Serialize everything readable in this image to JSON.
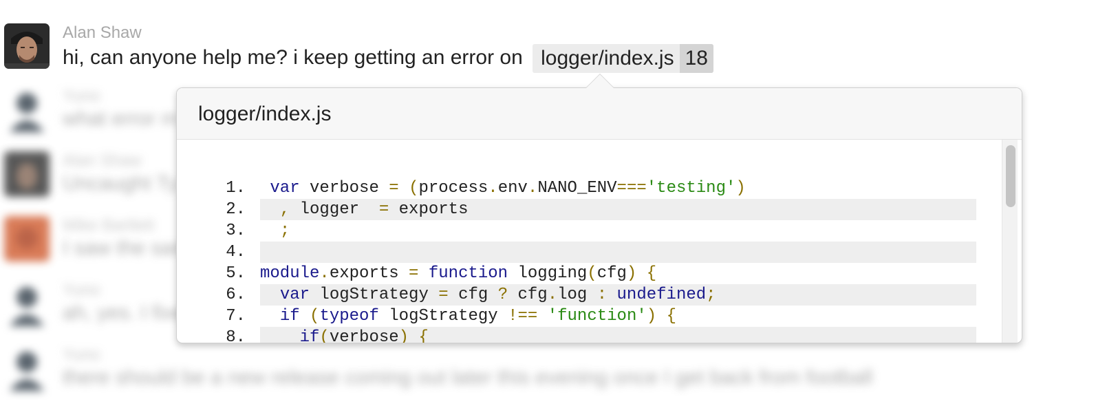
{
  "messages": [
    {
      "author": "Alan Shaw",
      "text": "hi, can anyone help me? i keep getting an error on",
      "file": "logger/index.js",
      "line": "18"
    },
    {
      "author": "Yuno",
      "text": "what error m"
    },
    {
      "author": "Alan Shaw",
      "text": "Uncaught Ty"
    },
    {
      "author": "Mike Bartlett",
      "text": "I saw the sam"
    },
    {
      "author": "Yuno",
      "text": "ah, yes. I fixe"
    },
    {
      "author": "Yuno",
      "text": "there should be a new release coming out later this evening once I get back from football"
    }
  ],
  "popover": {
    "title": "logger/index.js",
    "lines": [
      {
        "num": "1.",
        "tokens": [
          {
            "t": " "
          },
          {
            "t": "var",
            "c": "kw"
          },
          {
            "t": " verbose "
          },
          {
            "t": "=",
            "c": "op"
          },
          {
            "t": " "
          },
          {
            "t": "(",
            "c": "op"
          },
          {
            "t": "process"
          },
          {
            "t": ".",
            "c": "op"
          },
          {
            "t": "env"
          },
          {
            "t": ".",
            "c": "op"
          },
          {
            "t": "NANO_ENV"
          },
          {
            "t": "===",
            "c": "op"
          },
          {
            "t": "'testing'",
            "c": "str"
          },
          {
            "t": ")",
            "c": "op"
          }
        ]
      },
      {
        "num": "2.",
        "tokens": [
          {
            "t": "  "
          },
          {
            "t": ",",
            "c": "op"
          },
          {
            "t": " logger  "
          },
          {
            "t": "=",
            "c": "op"
          },
          {
            "t": " exports"
          }
        ]
      },
      {
        "num": "3.",
        "tokens": [
          {
            "t": "  "
          },
          {
            "t": ";",
            "c": "op"
          }
        ]
      },
      {
        "num": "4.",
        "tokens": []
      },
      {
        "num": "5.",
        "tokens": [
          {
            "t": "module",
            "c": "kw"
          },
          {
            "t": ".",
            "c": "op"
          },
          {
            "t": "exports "
          },
          {
            "t": "=",
            "c": "op"
          },
          {
            "t": " "
          },
          {
            "t": "function",
            "c": "kw"
          },
          {
            "t": " logging"
          },
          {
            "t": "(",
            "c": "op"
          },
          {
            "t": "cfg"
          },
          {
            "t": ")",
            "c": "op"
          },
          {
            "t": " "
          },
          {
            "t": "{",
            "c": "op"
          }
        ]
      },
      {
        "num": "6.",
        "tokens": [
          {
            "t": "  "
          },
          {
            "t": "var",
            "c": "kw"
          },
          {
            "t": " logStrategy "
          },
          {
            "t": "=",
            "c": "op"
          },
          {
            "t": " cfg "
          },
          {
            "t": "?",
            "c": "op"
          },
          {
            "t": " cfg"
          },
          {
            "t": ".",
            "c": "op"
          },
          {
            "t": "log "
          },
          {
            "t": ":",
            "c": "op"
          },
          {
            "t": " "
          },
          {
            "t": "undefined",
            "c": "kw"
          },
          {
            "t": ";",
            "c": "op"
          }
        ]
      },
      {
        "num": "7.",
        "tokens": [
          {
            "t": "  "
          },
          {
            "t": "if",
            "c": "kw"
          },
          {
            "t": " "
          },
          {
            "t": "(",
            "c": "op"
          },
          {
            "t": "typeof",
            "c": "kw"
          },
          {
            "t": " logStrategy "
          },
          {
            "t": "!==",
            "c": "op"
          },
          {
            "t": " "
          },
          {
            "t": "'function'",
            "c": "str"
          },
          {
            "t": ")",
            "c": "op"
          },
          {
            "t": " "
          },
          {
            "t": "{",
            "c": "op"
          }
        ]
      },
      {
        "num": "8.",
        "tokens": [
          {
            "t": "    "
          },
          {
            "t": "if",
            "c": "kw"
          },
          {
            "t": "(",
            "c": "op"
          },
          {
            "t": "verbose"
          },
          {
            "t": ")",
            "c": "op"
          },
          {
            "t": " "
          },
          {
            "t": "{",
            "c": "op"
          }
        ]
      }
    ]
  }
}
